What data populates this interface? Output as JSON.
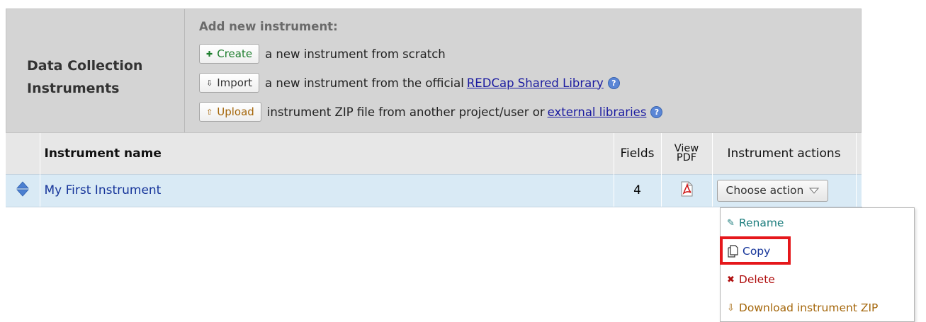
{
  "header": {
    "section_title": "Data Collection Instruments",
    "add_title": "Add new instrument:",
    "create_label": "Create",
    "create_text": "a new instrument from scratch",
    "import_label": "Import",
    "import_text": "a new instrument from the official",
    "import_link": "REDCap Shared Library",
    "upload_label": "Upload",
    "upload_text": "instrument ZIP file from another project/user or",
    "upload_link": "external libraries",
    "help_glyph": "?"
  },
  "table": {
    "columns": {
      "name": "Instrument name",
      "fields": "Fields",
      "pdf_line1": "View",
      "pdf_line2": "PDF",
      "actions": "Instrument actions"
    },
    "rows": [
      {
        "name": "My First Instrument",
        "fields": "4"
      }
    ]
  },
  "action_menu": {
    "trigger_label": "Choose action",
    "items": [
      {
        "label": "Rename",
        "icon": "pencil-icon",
        "color": "#1c7d7d"
      },
      {
        "label": "Copy",
        "icon": "copy-icon",
        "color": "#16359a",
        "highlighted": true
      },
      {
        "label": "Delete",
        "icon": "cross-icon",
        "color": "#b01010"
      },
      {
        "label": "Download instrument ZIP",
        "icon": "download-arrow-icon",
        "color": "#a4660a"
      }
    ]
  },
  "colors": {
    "header_bg": "#d4d4d4",
    "row_bg": "#d9eaf5",
    "highlight": "#e5171b"
  }
}
